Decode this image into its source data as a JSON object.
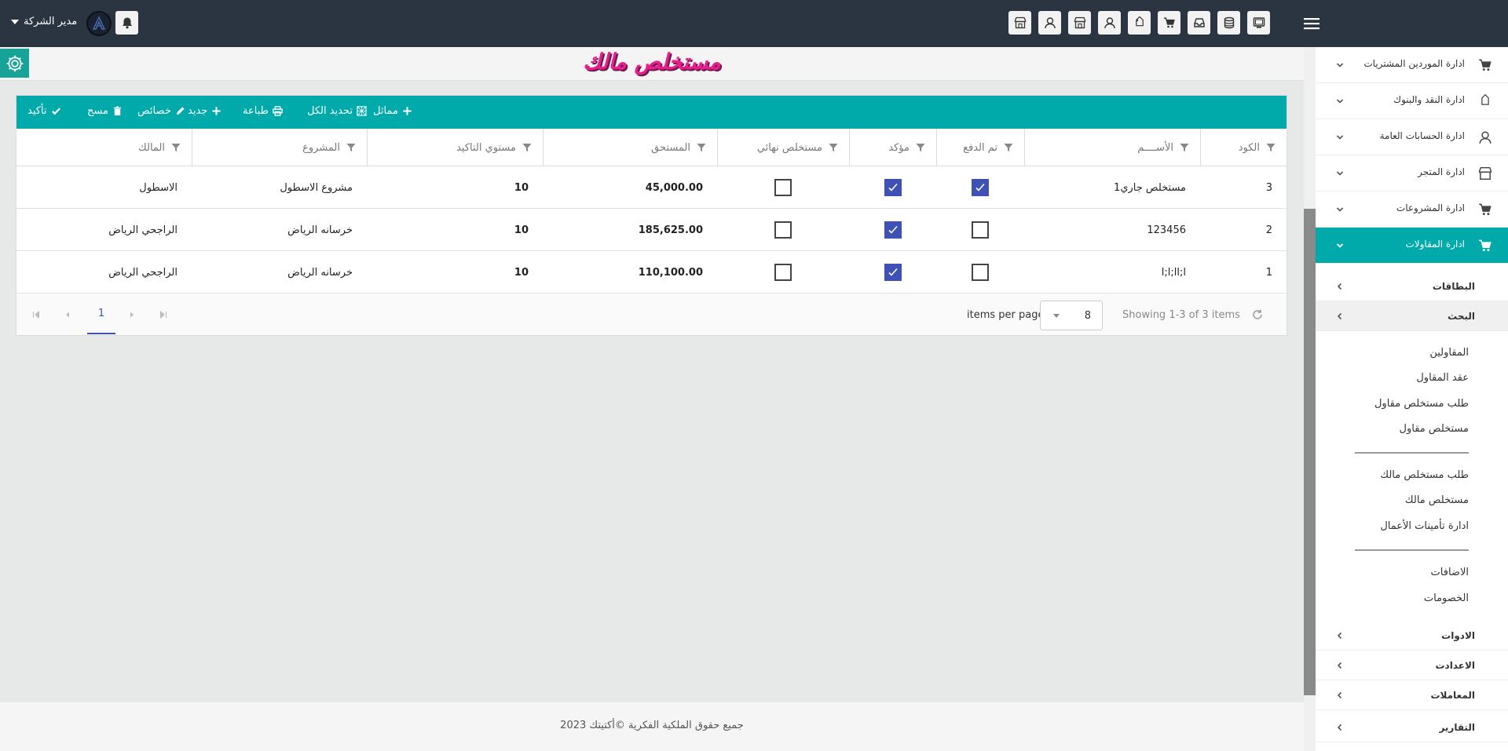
{
  "header": {
    "user_name": "مدير الشركة",
    "top_icons": [
      "monitor-icon",
      "database-icon",
      "inbox-icon",
      "cart-icon",
      "tag-icon",
      "user-icon",
      "store-icon",
      "user-icon",
      "store-icon"
    ]
  },
  "page": {
    "title": "مستخلص مالك"
  },
  "toolbar": {
    "confirm": "تأكيد",
    "delete": "مسح",
    "properties": "خصائص",
    "new": "جديد",
    "print": "طباعة",
    "select_all": "تحديد الكل",
    "similar": "مماثل"
  },
  "table": {
    "columns": [
      "الكود",
      "الأســــم",
      "تم الدفع",
      "مؤكد",
      "مستخلص نهائي",
      "المستحق",
      "مستوي التاكيد",
      "المشروع",
      "المالك"
    ],
    "rows": [
      {
        "code": "3",
        "name": "مستخلص جاري1",
        "paid": true,
        "confirmed": true,
        "final": false,
        "due": "45,000.00",
        "level": "10",
        "project": "مشروع الاسطول",
        "owner": "الاسطول"
      },
      {
        "code": "2",
        "name": "123456",
        "paid": false,
        "confirmed": true,
        "final": false,
        "due": "185,625.00",
        "level": "10",
        "project": "خرسانه الرياض",
        "owner": "الراجحي الرياض"
      },
      {
        "code": "1",
        "name": "l;l;ll;l",
        "paid": false,
        "confirmed": true,
        "final": false,
        "due": "110,100.00",
        "level": "10",
        "project": "خرسانه الرياض",
        "owner": "الراجحي الرياض"
      }
    ]
  },
  "pager": {
    "current_page": "1",
    "per_page": "8",
    "per_page_label": "items per page",
    "showing": "Showing 1-3 of 3 items"
  },
  "sidebar": {
    "items": [
      {
        "label": "ادارة الموردين المشتريات",
        "icon": "cart-icon"
      },
      {
        "label": "ادارة النقد والبنوك",
        "icon": "tag-icon"
      },
      {
        "label": "ادارة الحسابات العامة",
        "icon": "user-icon"
      },
      {
        "label": "ادارة المتجر",
        "icon": "store-icon"
      },
      {
        "label": "ادارة المشروعات",
        "icon": "cart-icon"
      },
      {
        "label": "ادارة المقاولات",
        "icon": "cart-icon",
        "active": true
      }
    ],
    "sub": {
      "cards": "البطاقات",
      "search": "البحث",
      "additions": "الاضافات",
      "tools": "الادوات",
      "settings": "الاعدادت",
      "transactions": "المعاملات",
      "reports": "التقارير"
    },
    "leaves": {
      "contractors": "المقاولين",
      "contract": "عقد المقاول",
      "contractor_claim_request": "طلب مستخلص مقاول",
      "contractor_claim": "مستخلص مقاول",
      "owner_claim_request": "طلب مستخلص مالك",
      "owner_claim": "مستخلص مالك",
      "works_insurance": "ادارة تأمينات الأعمال",
      "additions_leaf": "الاضافات",
      "deductions": "الخصومات"
    }
  },
  "footer": {
    "text": "جميع حقوق الملكية الفكرية ©أكتيتك 2023"
  },
  "colors": {
    "topbar": "#2b3541",
    "accent": "#00aaaa",
    "checkbox_on": "#3f51b5",
    "title": "#e91e8c"
  }
}
